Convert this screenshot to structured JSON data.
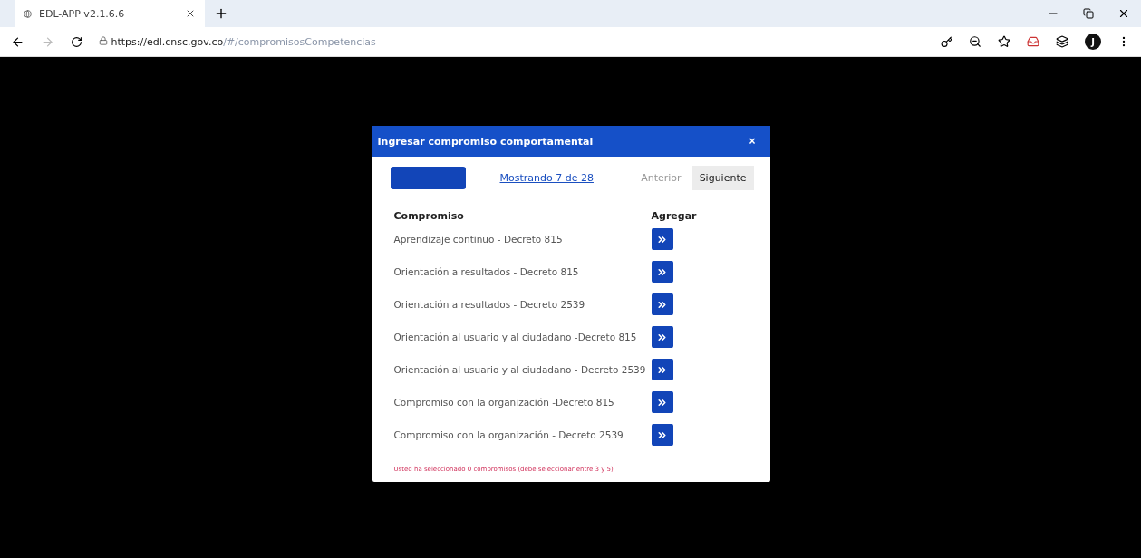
{
  "browser": {
    "tab_title": "EDL-APP v2.1.6.6",
    "url_host": "https://edl.cnsc.gov.co",
    "url_path": "/#/compromisosCompetencias",
    "profile_initial": "J"
  },
  "dialog": {
    "title": "Ingresar compromiso comportamental",
    "close": "×",
    "pager": {
      "status": "Mostrando 7 de 28",
      "buttons": [
        {
          "label": "Anterior",
          "disabled": true
        },
        {
          "label": "Siguiente",
          "disabled": false
        }
      ]
    },
    "columns": [
      "Compromiso",
      "Agregar"
    ],
    "rows": [
      {
        "name": "Aprendizaje continuo - Decreto 815"
      },
      {
        "name": "Orientación a resultados - Decreto 815"
      },
      {
        "name": "Orientación a resultados - Decreto 2539"
      },
      {
        "name": "Orientación al usuario y al ciudadano -Decreto 815"
      },
      {
        "name": "Orientación al usuario y al ciudadano - Decreto 2539"
      },
      {
        "name": "Compromiso con la organización -Decreto 815"
      },
      {
        "name": "Compromiso con la organización - Decreto 2539"
      }
    ],
    "footer": "Usted ha seleccionado 0 compromisos (debe seleccionar entre 3 y 5)"
  }
}
